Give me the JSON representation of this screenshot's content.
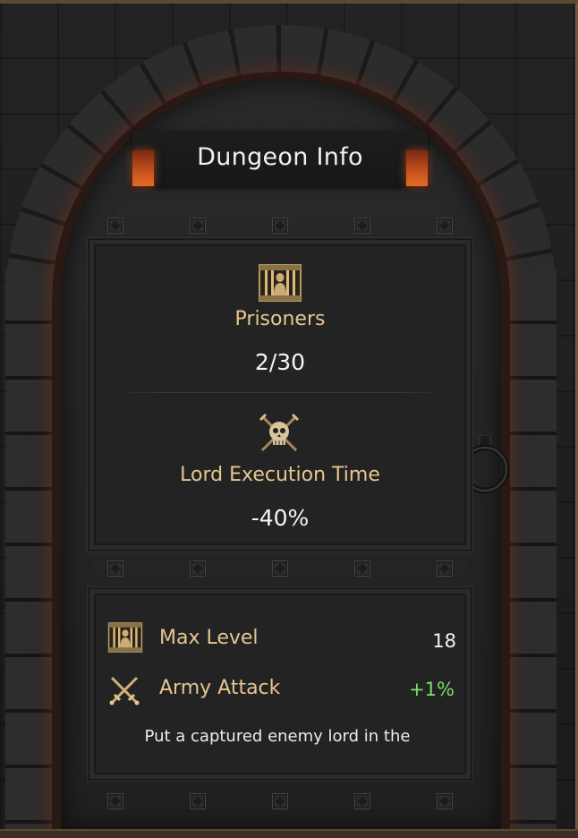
{
  "title": "Dungeon Info",
  "prisoners": {
    "icon": "prison-cell-icon",
    "label": "Prisoners",
    "value": "2/30"
  },
  "execution": {
    "icon": "skull-crossed-swords-icon",
    "label": "Lord Execution Time",
    "value": "-40%"
  },
  "stats": [
    {
      "icon": "prison-cell-icon",
      "label": "Max Level",
      "value": "18",
      "color": "#f4f4f4"
    },
    {
      "icon": "crossed-swords-icon",
      "label": "Army Attack",
      "value": "+1%",
      "color": "#7fdc6e"
    }
  ],
  "description": "Put a captured enemy lord in the",
  "colors": {
    "gold_label": "#e6c690",
    "positive": "#7fdc6e",
    "lamp": "#e46a24"
  }
}
